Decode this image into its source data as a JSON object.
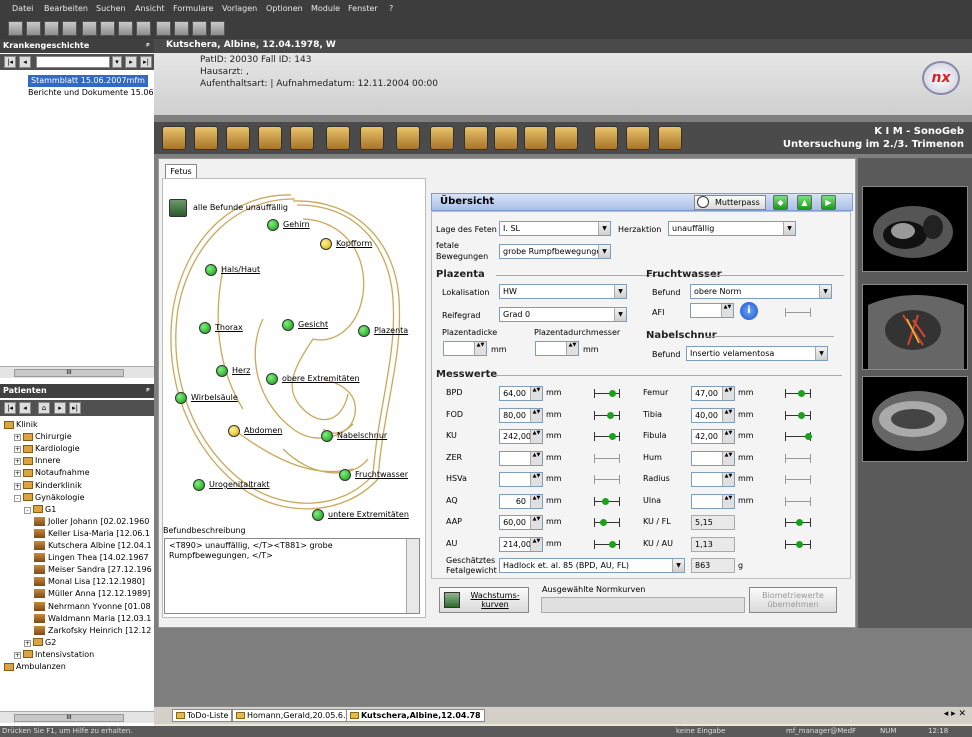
{
  "menu": [
    "Datei",
    "Bearbeiten",
    "Suchen",
    "Ansicht",
    "Formulare",
    "Vorlagen",
    "Optionen",
    "Module",
    "Fenster",
    "?"
  ],
  "left": {
    "history_title": "Krankengeschichte",
    "history_items": [
      "Stammblatt 15.06.2007mfm",
      "Berichte und Dokumente 15.06.20"
    ],
    "patients_title": "Patienten",
    "tree": [
      {
        "label": "Klinik",
        "level": 0,
        "box": ""
      },
      {
        "label": "Chirurgie",
        "level": 1,
        "box": "+"
      },
      {
        "label": "Kardiologie",
        "level": 1,
        "box": "+"
      },
      {
        "label": "Innere",
        "level": 1,
        "box": "+"
      },
      {
        "label": "Notaufnahme",
        "level": 1,
        "box": "+"
      },
      {
        "label": "Kinderklinik",
        "level": 1,
        "box": "+"
      },
      {
        "label": "Gynäkologie",
        "level": 1,
        "box": "-"
      },
      {
        "label": "G1",
        "level": 2,
        "box": "-"
      },
      {
        "label": "Joller Johann [02.02.1960",
        "level": 3,
        "box": "p"
      },
      {
        "label": "Keller Lisa-Maria [12.06.1",
        "level": 3,
        "box": "p"
      },
      {
        "label": "Kutschera Albine [12.04.1",
        "level": 3,
        "box": "p"
      },
      {
        "label": "Lingen Thea [14.02.1967",
        "level": 3,
        "box": "p"
      },
      {
        "label": "Meiser Sandra [27.12.196",
        "level": 3,
        "box": "p"
      },
      {
        "label": "Monal Lisa [12.12.1980]",
        "level": 3,
        "box": "p"
      },
      {
        "label": "Müller Anna [12.12.1989]",
        "level": 3,
        "box": "p"
      },
      {
        "label": "Nehrmann Yvonne [01.08",
        "level": 3,
        "box": "p"
      },
      {
        "label": "Waldmann Maria [12.03.1",
        "level": 3,
        "box": "p"
      },
      {
        "label": "Zarkofsky Heinrich [12.12",
        "level": 3,
        "box": "p"
      },
      {
        "label": "G2",
        "level": 2,
        "box": "+"
      },
      {
        "label": "Intensivstation",
        "level": 1,
        "box": "+"
      },
      {
        "label": "Ambulanzen",
        "level": 0,
        "box": ""
      }
    ],
    "scroll_label": "III"
  },
  "patient": {
    "header": "Kutschera, Albine, 12.04.1978, W",
    "line1": "PatID: 20030  Fall ID: 143",
    "line2": "Hausarzt: ,",
    "line3": "Aufenthaltsart: | Aufnahmedatum: 12.11.2004 00:00",
    "logo": "nx"
  },
  "module": {
    "title1": "K I M - SonoGeb",
    "title2": "Untersuchung im 2./3. Trimenon"
  },
  "fetus": {
    "tab": "Fetus",
    "all_label": "alle Befunde unauffällig",
    "points": [
      {
        "label": "Gehirn",
        "color": "green"
      },
      {
        "label": "Kopfform",
        "color": "yellow"
      },
      {
        "label": "Hals/Haut",
        "color": "green"
      },
      {
        "label": "Gesicht",
        "color": "green"
      },
      {
        "label": "Plazenta",
        "color": "green"
      },
      {
        "label": "Thorax",
        "color": "green"
      },
      {
        "label": "Herz",
        "color": "green"
      },
      {
        "label": "obere Extremitäten",
        "color": "green"
      },
      {
        "label": "Wirbelsäule",
        "color": "green"
      },
      {
        "label": "Abdomen",
        "color": "yellow"
      },
      {
        "label": "Nabelschnur",
        "color": "green"
      },
      {
        "label": "Fruchtwasser",
        "color": "green"
      },
      {
        "label": "Urogenitaltrakt",
        "color": "green"
      },
      {
        "label": "untere Extremitäten",
        "color": "green"
      }
    ],
    "befund_title": "Befundbeschreibung",
    "befund_text": "<T890> unauffällig, </T><T881> grobe Rumpfbewegungen, </T>"
  },
  "overview": {
    "title": "Übersicht",
    "mutterpass": "Mutterpass",
    "lage_label": "Lage des Feten",
    "lage_value": "I. SL",
    "herz_label": "Herzaktion",
    "herz_value": "unauffällig",
    "bew_label1": "fetale",
    "bew_label2": "Bewegungen",
    "bew_value": "grobe Rumpfbewegunge",
    "plazenta": {
      "title": "Plazenta",
      "lok_label": "Lokalisation",
      "lok_value": "HW",
      "reife_label": "Reifegrad",
      "reife_value": "Grad 0",
      "dicke_label": "Plazentadicke",
      "durch_label": "Plazentadurchmesser",
      "unit": "mm"
    },
    "fruchtwasser": {
      "title": "Fruchtwasser",
      "befund_label": "Befund",
      "befund_value": "obere Norm",
      "afi_label": "AFI"
    },
    "nabelschnur": {
      "title": "Nabelschnur",
      "befund_label": "Befund",
      "befund_value": "Insertio velamentosa"
    },
    "messwerte": {
      "title": "Messwerte",
      "unit": "mm",
      "left": [
        {
          "label": "BPD",
          "value": "64,00",
          "marker": 0.7
        },
        {
          "label": "FOD",
          "value": "80,00",
          "marker": 0.6
        },
        {
          "label": "KU",
          "value": "242,00",
          "marker": 0.7
        },
        {
          "label": "ZER",
          "value": "",
          "marker": null
        },
        {
          "label": "HSVa",
          "value": "",
          "marker": null
        },
        {
          "label": "AQ",
          "value": "60",
          "marker": 0.4
        },
        {
          "label": "AAP",
          "value": "60,00",
          "marker": 0.3
        },
        {
          "label": "AU",
          "value": "214,00",
          "marker": 0.7
        }
      ],
      "right": [
        {
          "label": "Femur",
          "value": "47,00",
          "marker": 0.6
        },
        {
          "label": "Tibia",
          "value": "40,00",
          "marker": 0.6
        },
        {
          "label": "Fibula",
          "value": "42,00",
          "marker": 0.95
        },
        {
          "label": "Hum",
          "value": "",
          "marker": null
        },
        {
          "label": "Radius",
          "value": "",
          "marker": null
        },
        {
          "label": "Ulna",
          "value": "",
          "marker": null
        }
      ],
      "ratios": [
        {
          "label": "KU / FL",
          "value": "5,15",
          "marker": 0.5
        },
        {
          "label": "KU / AU",
          "value": "1,13",
          "marker": 0.5
        }
      ],
      "gewicht_label1": "Geschätztes",
      "gewicht_label2": "Fetalgewicht",
      "gewicht_method": "Hadlock et. al. 85 (BPD, AU, FL)",
      "gewicht_value": "863",
      "gewicht_unit": "g"
    },
    "wachstum_btn1": "Wachstums-",
    "wachstum_btn2": "kurven",
    "normkurven_label": "Ausgewählte Normkurven",
    "bio_btn1": "Biometriewerte",
    "bio_btn2": "übernehmen"
  },
  "tabs": [
    "ToDo-Liste",
    "Homann,Gerald,20.05.6…",
    "Kutschera,Albine,12.04.78"
  ],
  "status": {
    "help": "Drücken Sie F1, um Hilfe zu erhalten.",
    "mode": "keine Eingabe",
    "user": "mf_manager@MedF",
    "num": "NUM",
    "time": "12:18"
  }
}
